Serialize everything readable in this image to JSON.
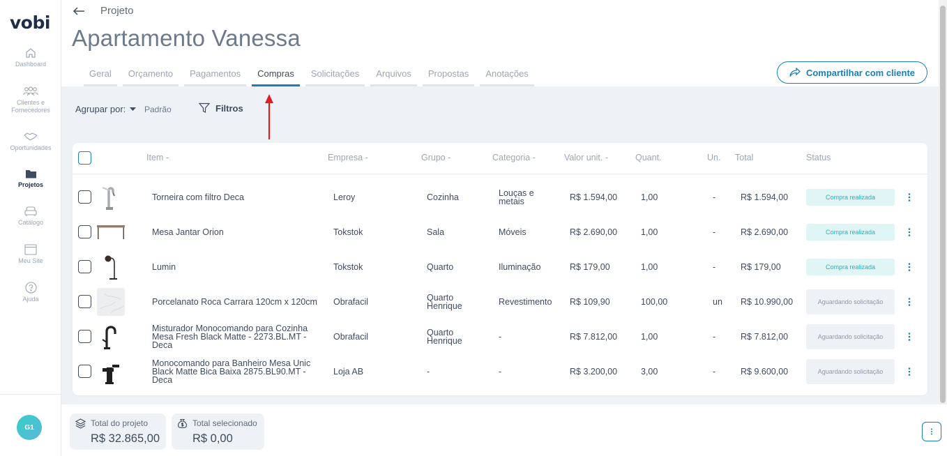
{
  "app": {
    "logo": "vobi"
  },
  "sidebar": {
    "items": [
      {
        "label": "Dashboard",
        "icon": "home-icon"
      },
      {
        "label": "Clientes e Fornecedores",
        "icon": "users-icon"
      },
      {
        "label": "Oportunidades",
        "icon": "handshake-icon"
      },
      {
        "label": "Projetos",
        "icon": "folder-icon",
        "active": true
      },
      {
        "label": "Catálogo",
        "icon": "sofa-icon"
      },
      {
        "label": "Meu Site",
        "icon": "browser-icon"
      },
      {
        "label": "Ajuda",
        "icon": "help-icon"
      }
    ],
    "avatar": "G1"
  },
  "header": {
    "breadcrumb": "Projeto",
    "title": "Apartamento Vanessa",
    "share_label": "Compartilhar com cliente"
  },
  "tabs": [
    "Geral",
    "Orçamento",
    "Pagamentos",
    "Compras",
    "Solicitações",
    "Arquivos",
    "Propostas",
    "Anotações"
  ],
  "active_tab": "Compras",
  "toolbar": {
    "group_by_label": "Agrupar por:",
    "group_by_value": "Padrão",
    "filters_label": "Filtros"
  },
  "table": {
    "columns": [
      "Item -",
      "Empresa -",
      "Grupo -",
      "Categoria -",
      "Valor unit. -",
      "Quant.",
      "Un.",
      "Total",
      "Status"
    ],
    "rows": [
      {
        "item": "Torneira com filtro Deca",
        "empresa": "Leroy",
        "grupo": "Cozinha",
        "categoria": "Louças e metais",
        "valor": "R$ 1.594,00",
        "quant": "1,00",
        "un": "-",
        "total": "R$ 1.594,00",
        "status": "Compra realizada",
        "status_type": "done",
        "thumb": "faucet"
      },
      {
        "item": "Mesa Jantar Orion",
        "empresa": "Tokstok",
        "grupo": "Sala",
        "categoria": "Móveis",
        "valor": "R$ 2.690,00",
        "quant": "1,00",
        "un": "-",
        "total": "R$ 2.690,00",
        "status": "Compra realizada",
        "status_type": "done",
        "thumb": "table"
      },
      {
        "item": "Lumin",
        "empresa": "Tokstok",
        "grupo": "Quarto",
        "categoria": "Iluminação",
        "valor": "R$ 179,00",
        "quant": "1,00",
        "un": "-",
        "total": "R$ 179,00",
        "status": "Compra realizada",
        "status_type": "done",
        "thumb": "lamp"
      },
      {
        "item": "Porcelanato Roca Carrara 120cm x 120cm",
        "empresa": "Obrafacil",
        "grupo": "Quarto Henrique",
        "categoria": "Revestimento",
        "valor": "R$ 109,90",
        "quant": "100,00",
        "un": "un",
        "total": "R$ 10.990,00",
        "status": "Aguardando solicitação",
        "status_type": "wait",
        "thumb": "tile"
      },
      {
        "item": "Misturador Monocomando para Cozinha Mesa Fresh Black Matte - 2273.BL.MT - Deca",
        "empresa": "Obrafacil",
        "grupo": "Quarto Henrique",
        "categoria": "-",
        "valor": "R$ 7.812,00",
        "quant": "1,00",
        "un": "-",
        "total": "R$ 7.812,00",
        "status": "Aguardando solicitação",
        "status_type": "wait",
        "thumb": "mixer"
      },
      {
        "item": "Monocomando para Banheiro Mesa Unic Black Matte Bica Baixa 2875.BL90.MT - Deca",
        "empresa": "Loja AB",
        "grupo": "-",
        "categoria": "-",
        "valor": "R$ 3.200,00",
        "quant": "3,00",
        "un": "-",
        "total": "R$ 9.600,00",
        "status": "Aguardando solicitação",
        "status_type": "wait",
        "thumb": "basin-faucet"
      }
    ]
  },
  "footer": {
    "total_project_label": "Total do projeto",
    "total_project_value": "R$ 32.865,00",
    "total_selected_label": "Total selecionado",
    "total_selected_value": "R$ 0,00"
  },
  "colors": {
    "accent": "#1a7fb5",
    "done_bg": "#dff5f6",
    "done_text": "#23b5bf",
    "wait_bg": "#eef1f6",
    "annotation": "#e02020"
  }
}
